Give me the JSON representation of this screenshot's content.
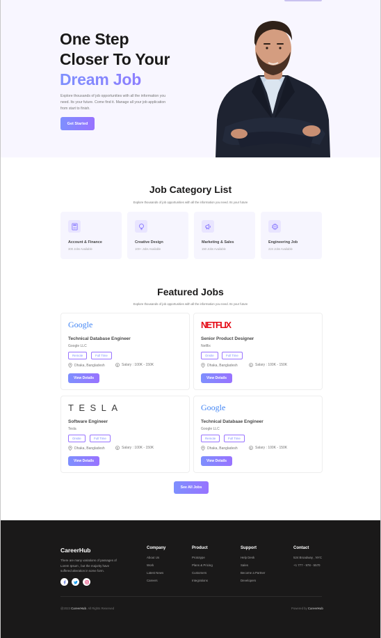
{
  "hero": {
    "title_line1": "One Step",
    "title_line2": "Closer To Your",
    "title_accent": "Dream Job",
    "description": "Explore thousands of job opportunities with all the information you need. Its your future. Come find it. Manage all your job application from start to finish.",
    "cta_label": "Get Started"
  },
  "categories": {
    "title": "Job Category List",
    "subtitle": "Explore thousands of job opportunities with all the information you need. Its your future",
    "items": [
      {
        "name": "Account & Finance",
        "count": "300 Jobs Available",
        "icon": "calculator-icon"
      },
      {
        "name": "Creative Design",
        "count": "100+ Jobs Available",
        "icon": "lightbulb-icon"
      },
      {
        "name": "Marketing & Sales",
        "count": "150 Jobs Available",
        "icon": "megaphone-icon"
      },
      {
        "name": "Engineering Job",
        "count": "224 Jobs Available",
        "icon": "chip-icon"
      }
    ]
  },
  "featured": {
    "title": "Featured Jobs",
    "subtitle": "Explore thousands of job opportunities with all the information you need. Its your future",
    "detail_label": "View Details",
    "see_all_label": "See All Jobs",
    "jobs": [
      {
        "logo": "Google",
        "title": "Technical Database Engineer",
        "company": "Google LLC",
        "type1": "Remote",
        "type2": "Full Time",
        "location": "Dhaka, Bangladesh",
        "salary": "Salary : 100K - 150K"
      },
      {
        "logo": "NETFLIX",
        "title": "Senior Product Designer",
        "company": "Netflix",
        "type1": "Onsite",
        "type2": "Full Time",
        "location": "Dhaka, Bangladesh",
        "salary": "Salary : 100K - 150K"
      },
      {
        "logo": "TESLA",
        "title": "Software Engineer",
        "company": "Tesla",
        "type1": "Onsite",
        "type2": "Full Time",
        "location": "Dhaka, Bangladesh",
        "salary": "Salary : 100K - 150K"
      },
      {
        "logo": "Google",
        "title": "Technical Databaae Engineer",
        "company": "Google LLC",
        "type1": "Remote",
        "type2": "Full Time",
        "location": "Dhaka, Bangladesh",
        "salary": "Salary : 100K - 150K"
      }
    ]
  },
  "footer": {
    "brand": "CareerHub",
    "description": "There are many variations of passages of Lorem Ipsum , but the majority have suffered alteration in some form.",
    "columns": [
      {
        "title": "Company",
        "links": [
          "About Us",
          "Work",
          "Latest News",
          "Careers"
        ]
      },
      {
        "title": "Product",
        "links": [
          "Prototype",
          "Plans & Pricing",
          "Customers",
          "Integrations"
        ]
      },
      {
        "title": "Support",
        "links": [
          "Help Desk",
          "Sales",
          "Become a Partner",
          "Developers"
        ]
      },
      {
        "title": "Contact",
        "links": [
          "524 Broadway , NYC",
          "+1 777 - 978 - 5570"
        ]
      }
    ],
    "copyright_prefix": "@2023",
    "copyright_brand": "CareerHub",
    "copyright_suffix": ". All Rights Reserved",
    "credit_prefix": "Powered by",
    "credit_brand": "CareerHub"
  },
  "colors": {
    "accent_start": "#7e8ffe",
    "accent_end": "#9873ff",
    "hero_bg": "#f8f6ff",
    "footer_bg": "#1a1919"
  }
}
